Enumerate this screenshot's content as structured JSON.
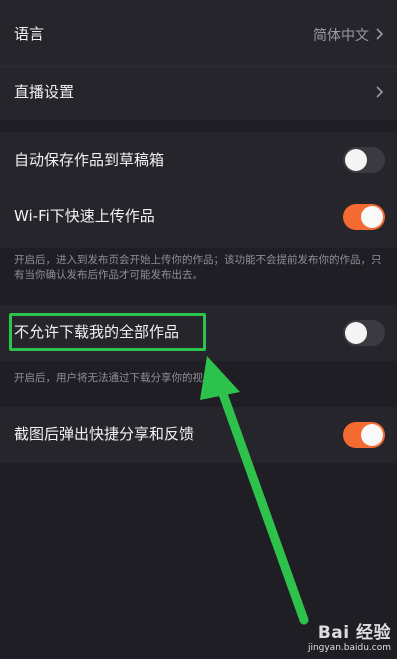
{
  "settings": {
    "language": {
      "label": "语言",
      "value": "简体中文"
    },
    "live": {
      "label": "直播设置"
    },
    "autosave": {
      "label": "自动保存作品到草稿箱",
      "enabled": false
    },
    "wifi_upload": {
      "label": "Wi-Fi下快速上传作品",
      "enabled": true
    },
    "wifi_note": "开启后，进入到发布页会开始上传你的作品；该功能不会提前发布你的作品，只有当你确认发布后作品才可能发布出去。",
    "no_download": {
      "label": "不允许下载我的全部作品",
      "enabled": false
    },
    "no_download_note": "开启后，用户将无法通过下载分享你的视频。",
    "screenshot_share": {
      "label": "截图后弹出快捷分享和反馈",
      "enabled": true
    }
  },
  "watermark": {
    "logo": "Bai 经验",
    "url": "jingyan.baidu.com"
  },
  "colors": {
    "background": "#1f1e24",
    "row": "#26252b",
    "toggle_on": "#f46a31",
    "toggle_off": "#3b3a41",
    "annotation_green": "#2dc24b"
  }
}
